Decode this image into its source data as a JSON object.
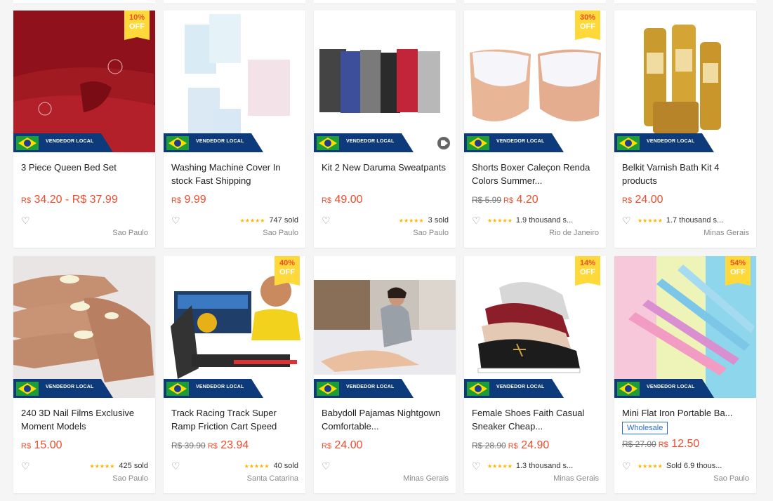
{
  "vendor_label": "VENDEDOR LOCAL",
  "colors": {
    "accent": "#ee4d2d",
    "badge": "#ffd839",
    "vendor": "#0c3a7a"
  },
  "products": [
    {
      "title": "3 Piece Queen Bed Set",
      "price": "34.20 - R$ 37.99",
      "currency": "R$",
      "location": "Sao Paulo",
      "sold": "",
      "stars": "",
      "discount": "10%",
      "discount_off": "OFF",
      "video": false
    },
    {
      "title": "Washing Machine Cover In stock Fast Shipping",
      "price": "9.99",
      "currency": "R$",
      "location": "Sao Paulo",
      "sold": "747 sold",
      "stars": "★★★★★",
      "discount": "",
      "discount_off": "",
      "video": false
    },
    {
      "title": "Kit 2 New Daruma Sweatpants",
      "price": "49.00",
      "currency": "R$",
      "location": "Sao Paulo",
      "sold": "3 sold",
      "stars": "★★★★★",
      "discount": "",
      "discount_off": "",
      "video": true
    },
    {
      "title": "Shorts Boxer Caleçon Renda Colors Summer...",
      "old_price": "R$ 5.99",
      "price": "4.20",
      "currency": "R$",
      "location": "Rio de Janeiro",
      "sold": "1.9 thousand s...",
      "stars": "★★★★★",
      "discount": "30%",
      "discount_off": "OFF",
      "video": false
    },
    {
      "title": "Belkit Varnish Bath Kit 4 products",
      "price": "24.00",
      "currency": "R$",
      "location": "Minas Gerais",
      "sold": "1.7 thousand s...",
      "stars": "★★★★★",
      "discount": "",
      "discount_off": "",
      "video": false
    },
    {
      "title": "240 3D Nail Films Exclusive Moment Models",
      "price": "15.00",
      "currency": "R$",
      "location": "Sao Paulo",
      "sold": "425 sold",
      "stars": "★★★★★",
      "discount": "",
      "discount_off": "",
      "video": false
    },
    {
      "title": "Track Racing Track Super Ramp Friction Cart Speed",
      "old_price": "R$ 39.90",
      "price": "23.94",
      "currency": "R$",
      "location": "Santa Catarina",
      "sold": "40 sold",
      "stars": "★★★★★",
      "discount": "40%",
      "discount_off": "OFF",
      "video": false
    },
    {
      "title": "Babydoll Pajamas Nightgown Comfortable...",
      "price": "24.00",
      "currency": "R$",
      "location": "Minas Gerais",
      "sold": "",
      "stars": "",
      "discount": "",
      "discount_off": "",
      "video": false
    },
    {
      "title": "Female Shoes Faith Casual Sneaker Cheap...",
      "old_price": "R$ 28.90",
      "price": "24.90",
      "currency": "R$",
      "location": "Minas Gerais",
      "sold": "1.3 thousand s...",
      "stars": "★★★★★",
      "discount": "14%",
      "discount_off": "OFF",
      "video": false
    },
    {
      "title": "Mini Flat Iron Portable Ba...",
      "wholesale": "Wholesale",
      "old_price": "R$ 27.00",
      "price": "12.50",
      "currency": "R$",
      "location": "Sao Paulo",
      "sold": "Sold 6.9 thous...",
      "stars": "★★★★★",
      "discount": "54%",
      "discount_off": "OFF",
      "video": false
    }
  ]
}
